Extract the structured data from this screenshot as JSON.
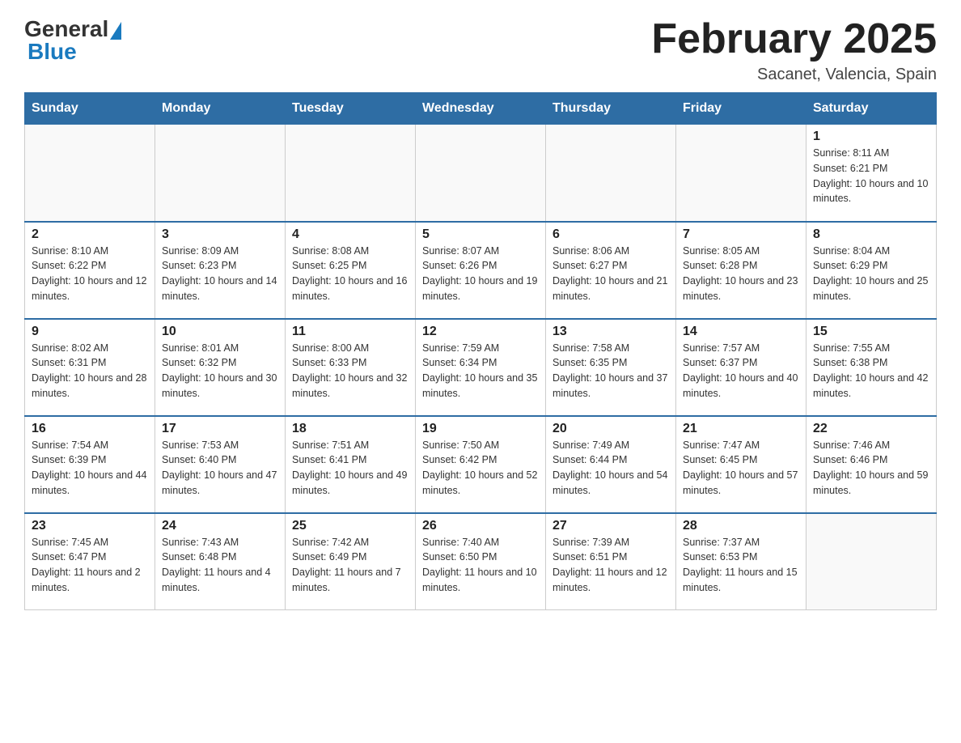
{
  "logo": {
    "text_general": "General",
    "text_blue": "Blue"
  },
  "header": {
    "month_title": "February 2025",
    "location": "Sacanet, Valencia, Spain"
  },
  "weekdays": [
    "Sunday",
    "Monday",
    "Tuesday",
    "Wednesday",
    "Thursday",
    "Friday",
    "Saturday"
  ],
  "weeks": [
    [
      {
        "day": "",
        "sunrise": "",
        "sunset": "",
        "daylight": ""
      },
      {
        "day": "",
        "sunrise": "",
        "sunset": "",
        "daylight": ""
      },
      {
        "day": "",
        "sunrise": "",
        "sunset": "",
        "daylight": ""
      },
      {
        "day": "",
        "sunrise": "",
        "sunset": "",
        "daylight": ""
      },
      {
        "day": "",
        "sunrise": "",
        "sunset": "",
        "daylight": ""
      },
      {
        "day": "",
        "sunrise": "",
        "sunset": "",
        "daylight": ""
      },
      {
        "day": "1",
        "sunrise": "Sunrise: 8:11 AM",
        "sunset": "Sunset: 6:21 PM",
        "daylight": "Daylight: 10 hours and 10 minutes."
      }
    ],
    [
      {
        "day": "2",
        "sunrise": "Sunrise: 8:10 AM",
        "sunset": "Sunset: 6:22 PM",
        "daylight": "Daylight: 10 hours and 12 minutes."
      },
      {
        "day": "3",
        "sunrise": "Sunrise: 8:09 AM",
        "sunset": "Sunset: 6:23 PM",
        "daylight": "Daylight: 10 hours and 14 minutes."
      },
      {
        "day": "4",
        "sunrise": "Sunrise: 8:08 AM",
        "sunset": "Sunset: 6:25 PM",
        "daylight": "Daylight: 10 hours and 16 minutes."
      },
      {
        "day": "5",
        "sunrise": "Sunrise: 8:07 AM",
        "sunset": "Sunset: 6:26 PM",
        "daylight": "Daylight: 10 hours and 19 minutes."
      },
      {
        "day": "6",
        "sunrise": "Sunrise: 8:06 AM",
        "sunset": "Sunset: 6:27 PM",
        "daylight": "Daylight: 10 hours and 21 minutes."
      },
      {
        "day": "7",
        "sunrise": "Sunrise: 8:05 AM",
        "sunset": "Sunset: 6:28 PM",
        "daylight": "Daylight: 10 hours and 23 minutes."
      },
      {
        "day": "8",
        "sunrise": "Sunrise: 8:04 AM",
        "sunset": "Sunset: 6:29 PM",
        "daylight": "Daylight: 10 hours and 25 minutes."
      }
    ],
    [
      {
        "day": "9",
        "sunrise": "Sunrise: 8:02 AM",
        "sunset": "Sunset: 6:31 PM",
        "daylight": "Daylight: 10 hours and 28 minutes."
      },
      {
        "day": "10",
        "sunrise": "Sunrise: 8:01 AM",
        "sunset": "Sunset: 6:32 PM",
        "daylight": "Daylight: 10 hours and 30 minutes."
      },
      {
        "day": "11",
        "sunrise": "Sunrise: 8:00 AM",
        "sunset": "Sunset: 6:33 PM",
        "daylight": "Daylight: 10 hours and 32 minutes."
      },
      {
        "day": "12",
        "sunrise": "Sunrise: 7:59 AM",
        "sunset": "Sunset: 6:34 PM",
        "daylight": "Daylight: 10 hours and 35 minutes."
      },
      {
        "day": "13",
        "sunrise": "Sunrise: 7:58 AM",
        "sunset": "Sunset: 6:35 PM",
        "daylight": "Daylight: 10 hours and 37 minutes."
      },
      {
        "day": "14",
        "sunrise": "Sunrise: 7:57 AM",
        "sunset": "Sunset: 6:37 PM",
        "daylight": "Daylight: 10 hours and 40 minutes."
      },
      {
        "day": "15",
        "sunrise": "Sunrise: 7:55 AM",
        "sunset": "Sunset: 6:38 PM",
        "daylight": "Daylight: 10 hours and 42 minutes."
      }
    ],
    [
      {
        "day": "16",
        "sunrise": "Sunrise: 7:54 AM",
        "sunset": "Sunset: 6:39 PM",
        "daylight": "Daylight: 10 hours and 44 minutes."
      },
      {
        "day": "17",
        "sunrise": "Sunrise: 7:53 AM",
        "sunset": "Sunset: 6:40 PM",
        "daylight": "Daylight: 10 hours and 47 minutes."
      },
      {
        "day": "18",
        "sunrise": "Sunrise: 7:51 AM",
        "sunset": "Sunset: 6:41 PM",
        "daylight": "Daylight: 10 hours and 49 minutes."
      },
      {
        "day": "19",
        "sunrise": "Sunrise: 7:50 AM",
        "sunset": "Sunset: 6:42 PM",
        "daylight": "Daylight: 10 hours and 52 minutes."
      },
      {
        "day": "20",
        "sunrise": "Sunrise: 7:49 AM",
        "sunset": "Sunset: 6:44 PM",
        "daylight": "Daylight: 10 hours and 54 minutes."
      },
      {
        "day": "21",
        "sunrise": "Sunrise: 7:47 AM",
        "sunset": "Sunset: 6:45 PM",
        "daylight": "Daylight: 10 hours and 57 minutes."
      },
      {
        "day": "22",
        "sunrise": "Sunrise: 7:46 AM",
        "sunset": "Sunset: 6:46 PM",
        "daylight": "Daylight: 10 hours and 59 minutes."
      }
    ],
    [
      {
        "day": "23",
        "sunrise": "Sunrise: 7:45 AM",
        "sunset": "Sunset: 6:47 PM",
        "daylight": "Daylight: 11 hours and 2 minutes."
      },
      {
        "day": "24",
        "sunrise": "Sunrise: 7:43 AM",
        "sunset": "Sunset: 6:48 PM",
        "daylight": "Daylight: 11 hours and 4 minutes."
      },
      {
        "day": "25",
        "sunrise": "Sunrise: 7:42 AM",
        "sunset": "Sunset: 6:49 PM",
        "daylight": "Daylight: 11 hours and 7 minutes."
      },
      {
        "day": "26",
        "sunrise": "Sunrise: 7:40 AM",
        "sunset": "Sunset: 6:50 PM",
        "daylight": "Daylight: 11 hours and 10 minutes."
      },
      {
        "day": "27",
        "sunrise": "Sunrise: 7:39 AM",
        "sunset": "Sunset: 6:51 PM",
        "daylight": "Daylight: 11 hours and 12 minutes."
      },
      {
        "day": "28",
        "sunrise": "Sunrise: 7:37 AM",
        "sunset": "Sunset: 6:53 PM",
        "daylight": "Daylight: 11 hours and 15 minutes."
      },
      {
        "day": "",
        "sunrise": "",
        "sunset": "",
        "daylight": ""
      }
    ]
  ]
}
